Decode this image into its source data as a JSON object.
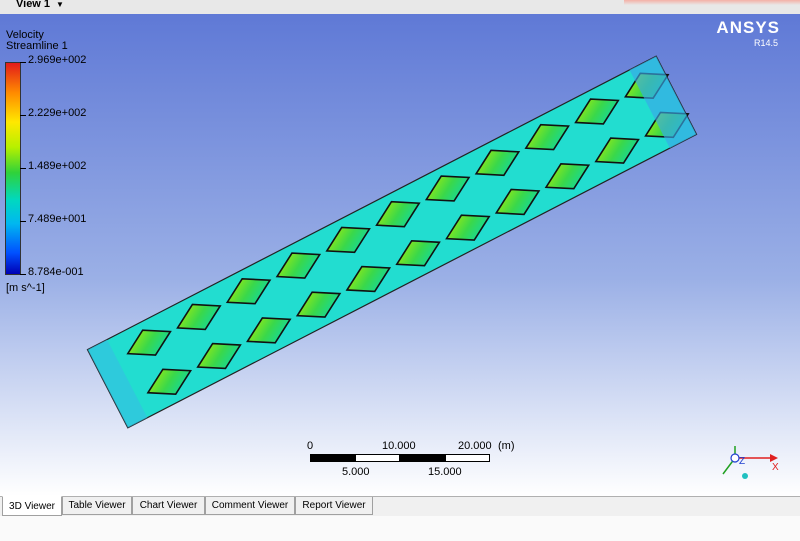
{
  "toolbar": {
    "view_label": "View 1"
  },
  "brand": {
    "name": "ANSYS",
    "version": "R14.5"
  },
  "legend": {
    "variable": "Velocity",
    "object": "Streamline 1",
    "ticks": [
      "2.969e+002",
      "2.229e+002",
      "1.489e+002",
      "7.489e+001",
      "8.784e-001"
    ],
    "units": "[m s^-1]"
  },
  "scale": {
    "top_labels": [
      "0",
      "10.000",
      "20.000",
      "(m)"
    ],
    "bottom_labels": [
      "5.000",
      "15.000"
    ]
  },
  "axes": {
    "x": "X",
    "z": "Z"
  },
  "tabs": [
    "3D Viewer",
    "Table Viewer",
    "Chart Viewer",
    "Comment Viewer",
    "Report Viewer"
  ]
}
